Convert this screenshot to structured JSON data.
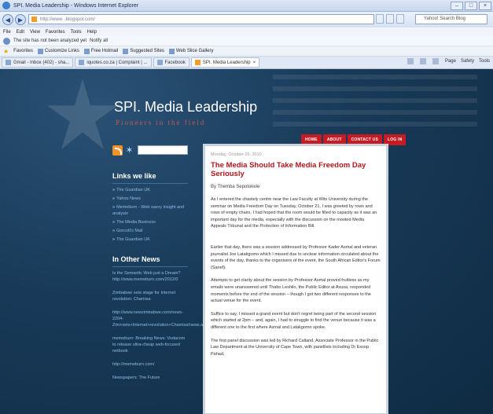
{
  "browser": {
    "window_title": "SPI. Media Leadership - Windows Internet Explorer",
    "url": "http://www.          .blogspot.com/",
    "search_placeholder": "Yahoo! Search Blog",
    "menu": [
      "File",
      "Edit",
      "View",
      "Favorites",
      "Tools",
      "Help"
    ],
    "status_message": "The site has not been analyzed yet",
    "status_extra": "Notify all",
    "favorites_label": "Favorites",
    "favorites": [
      "Customize Links",
      "Free Hotmail",
      "Suggested Sites",
      "Web Slice Gallery"
    ],
    "tabs": [
      {
        "label": "Gmail - Inbox (402) - sha..."
      },
      {
        "label": "iquotes.co.za | Complaint | ..."
      },
      {
        "label": "Facebook"
      },
      {
        "label": "SPI. Media Leadership"
      }
    ],
    "tab_tools": [
      "Page",
      "Safety",
      "Tools"
    ]
  },
  "blog": {
    "title": "SPI. Media Leadership",
    "description": "Pioneers in the field",
    "nav": [
      "HOME",
      "ABOUT",
      "CONTACT US",
      "LOG IN"
    ]
  },
  "sidebar": {
    "links_heading": "Links we like",
    "links": [
      "The Guardian UK",
      "Yahoo News",
      "Memeburn - Web savvy insight and analysis",
      "The Media Business",
      "Gorcott's Mail",
      "The Guardian UK"
    ],
    "news_heading": "In Other News",
    "news": [
      "Is the Semantic Web just a Dream? http://www.memeburn.com/2012/0",
      "Zimbabwe sets stage for Internet revolution: Chamisa",
      "http://www.newzimbabwe.com/news-2204-Zim+sets+Internet+revolution+Chamisa/news.aspx",
      "memeburn: Breaking News: Vodacom to release ultra-cheap web-focused netbook",
      "http://memeburn.com/",
      "Newspapers: The Future"
    ]
  },
  "post": {
    "date": "Monday, October 25, 2010",
    "title": "The Media Should Take Media Freedom Day Seriously",
    "author": "By Themba Sepotokele",
    "paragraphs": [
      "As I entered the chastely centre near the Law Faculty at Wits University during the seminar on Media Freedom Day on Tuesday, October 21, I was greeted by rows and rows of empty chairs. I had hoped that the room would be filled to capacity as it was an important day for the media, especially with the discussion on the mooted Media Appeals Tribunal and the Protection of Information Bill.",
      "Earlier that day, there was a session addressed by Professor Kader Asmal and veteran journalist Joe Latakgomo which I missed due to unclear information circulated about the events of the day, thanks to the organisers of the event, the South African Editor's Forum (Sanef).",
      "Attempts to get clarity about the session by Professor Asmal proved fruitless as my emails were unanswered until Thabo Leshilo, the Public Editor at Avusa, responded moments before the end of the session – though I got two different responses to the actual venue for the event.",
      "Suffice to say, I missed a grand event but don't regret being part of the second session which started at 2pm – and, again, I had to struggle to find the venue because it was a different one to the first where Asmal and Latakgomo spoke.",
      "The first panel discussion was led by Richard Calland, Associate Professor in the Public Law Department at the University of Cape Town, with panellists including Dr Essop Pahad,"
    ]
  }
}
